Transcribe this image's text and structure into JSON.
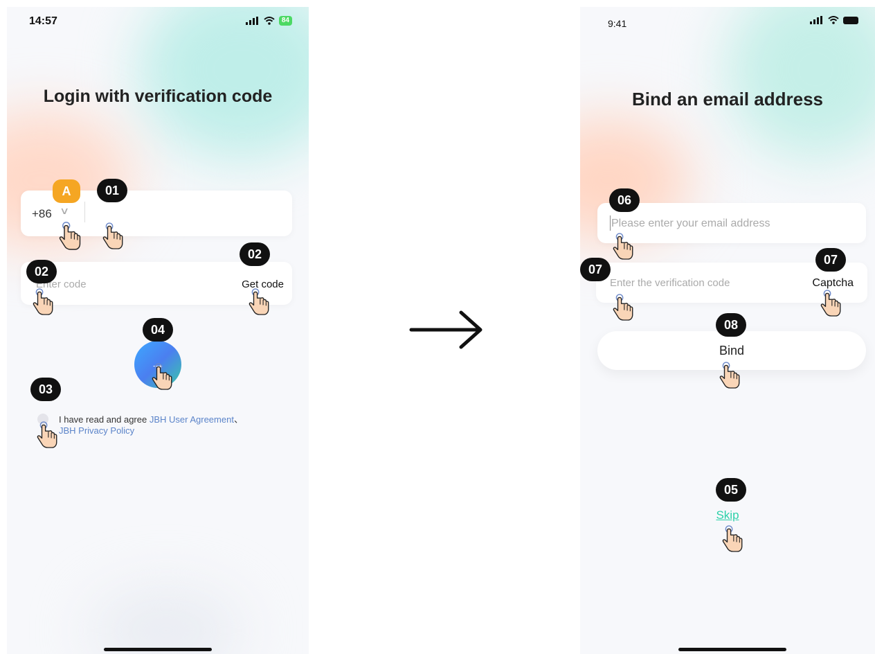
{
  "left_screen": {
    "status": {
      "time": "14:57",
      "battery": "84"
    },
    "title": "Login with verification code",
    "phone_field": {
      "country_code": "+86",
      "placeholder": ""
    },
    "code_field": {
      "placeholder": "Enter code",
      "action_label": "Get code"
    },
    "submit_button": {
      "icon": "arrow-right-icon",
      "glyph": "→"
    },
    "agreement": {
      "prefix": "I have read and agree ",
      "user_agreement": "JBH User Agreement",
      "separator": "、",
      "privacy_policy": "JBH Privacy Policy"
    }
  },
  "right_screen": {
    "status": {
      "time": "9:41"
    },
    "title": "Bind an email address",
    "email_field": {
      "placeholder": "Please enter your email address"
    },
    "code_field": {
      "placeholder": "Enter the verification code",
      "action_label": "Captcha"
    },
    "bind_button": {
      "label": "Bind"
    },
    "skip_link": {
      "label": "Skip"
    }
  },
  "annotations": {
    "badge_a": "A",
    "step_01": "01",
    "step_02": "02",
    "step_03": "03",
    "step_04": "04",
    "step_05": "05",
    "step_06": "06",
    "step_07": "07",
    "step_08": "08",
    "pointer_icon": "pointing-hand-icon",
    "flow_arrow_icon": "long-arrow-right-icon"
  },
  "colors": {
    "accent_link": "#5b84c9",
    "skip_green": "#2bd0a8",
    "badge_black": "#111111",
    "badge_orange": "#f5a623",
    "button_gradient_start": "#3da8ff",
    "button_gradient_end": "#3ac8a7"
  }
}
